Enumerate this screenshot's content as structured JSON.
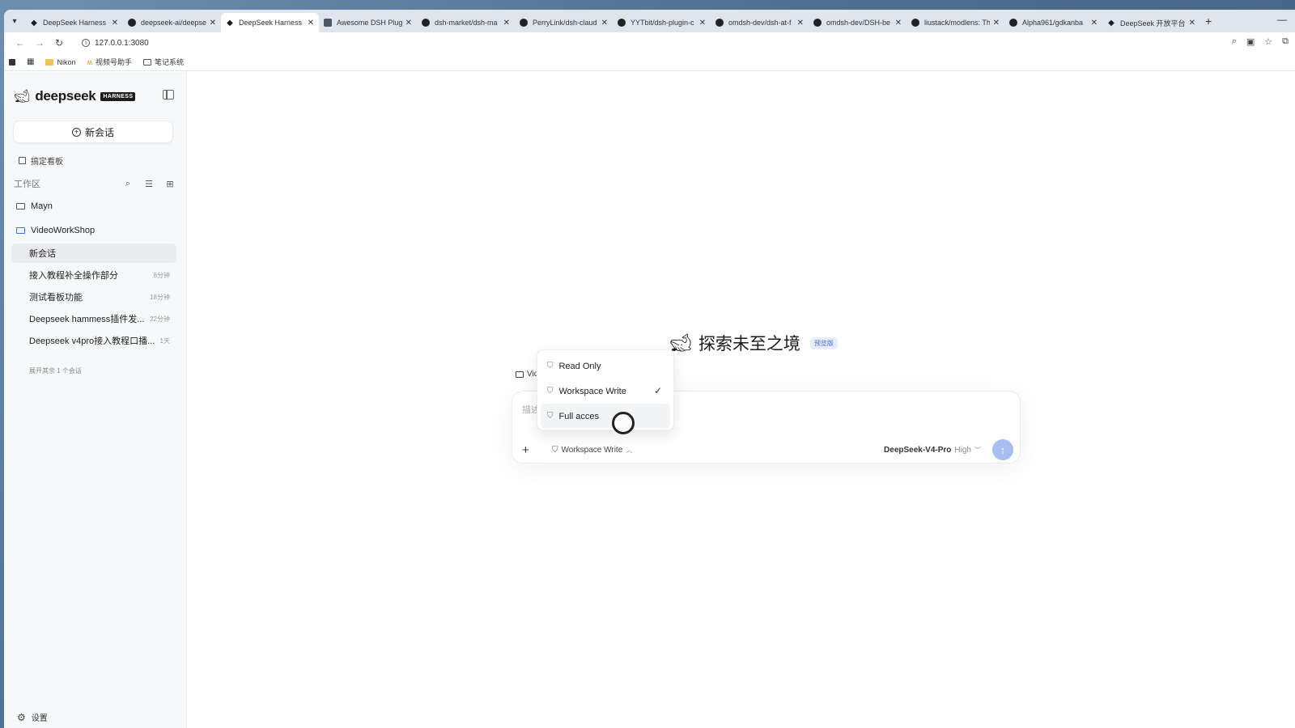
{
  "browser": {
    "tabs": [
      {
        "title": "DeepSeek Harness F",
        "icon": "deepseek"
      },
      {
        "title": "deepseek-ai/deepse",
        "icon": "github"
      },
      {
        "title": "DeepSeek Harness",
        "icon": "deepseek",
        "active": true
      },
      {
        "title": "Awesome DSH Plugi",
        "icon": "doc"
      },
      {
        "title": "dsh-market/dsh-ma",
        "icon": "github"
      },
      {
        "title": "PerryLink/dsh-claud",
        "icon": "github"
      },
      {
        "title": "YYTbit/dsh-plugin-c",
        "icon": "github"
      },
      {
        "title": "omdsh-dev/dsh-at-f",
        "icon": "github"
      },
      {
        "title": "omdsh-dev/DSH-be",
        "icon": "github"
      },
      {
        "title": "liustack/modlens: Th",
        "icon": "github"
      },
      {
        "title": "Alpha961/gdkanba",
        "icon": "github"
      },
      {
        "title": "DeepSeek 开放平台",
        "icon": "deepseek"
      }
    ],
    "url": "127.0.0.1:3080",
    "bookmarks": [
      "Nikon",
      "视频号助手",
      "笔记系统"
    ]
  },
  "sidebar": {
    "brand_name": "deepseek",
    "brand_badge": "HARNESS",
    "new_chat_label": "新会话",
    "kanban_label": "搞定看板",
    "workspace_label": "工作区",
    "folders": [
      {
        "name": "Mayn"
      },
      {
        "name": "VideoWorkShop"
      }
    ],
    "conversations": [
      {
        "title": "新会话",
        "time": "",
        "active": true
      },
      {
        "title": "接入教程补全操作部分",
        "time": "8分钟"
      },
      {
        "title": "测试看板功能",
        "time": "18分钟"
      },
      {
        "title": "Deepseek hammess插件发...",
        "time": "22分钟"
      },
      {
        "title": "Deepseek v4pro接入教程口播...",
        "time": "1天"
      }
    ],
    "more_link": "展开其余 1 个会话",
    "settings_label": "设置"
  },
  "main": {
    "hero_title": "探索未至之境",
    "hero_badge": "预览版",
    "workspace_chip": "Vide",
    "composer": {
      "placeholder": "描述任",
      "permission_label": "Workspace Write",
      "model_name": "DeepSeek-V4-Pro",
      "model_level": "High"
    },
    "permission_menu": [
      {
        "label": "Read Only"
      },
      {
        "label": "Workspace Write",
        "checked": true
      },
      {
        "label": "Full acces",
        "hover": true
      }
    ]
  },
  "colors": {
    "accent": "#3d6fd6",
    "send_button": "#a9bdf0",
    "preview_badge_bg": "#e8eefc"
  }
}
